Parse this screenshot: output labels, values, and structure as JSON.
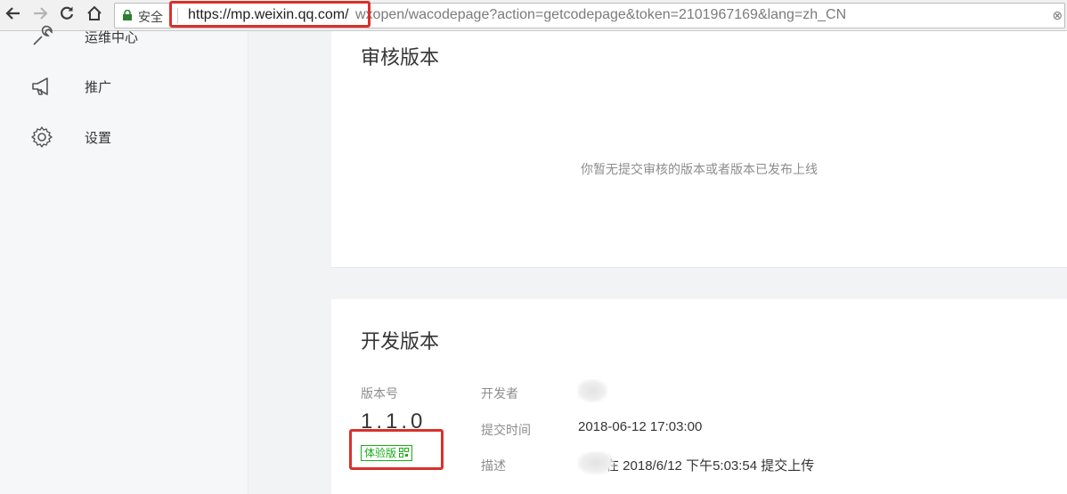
{
  "browser": {
    "secure_label": "安全",
    "url_host": "https://mp.weixin.qq.com/",
    "url_path": "wxopen/wacodepage?action=getcodepage&token=2101967169&lang=zh_CN"
  },
  "sidebar": {
    "items": [
      {
        "label": "运维中心",
        "icon": "wrench-icon"
      },
      {
        "label": "推广",
        "icon": "megaphone-icon"
      },
      {
        "label": "设置",
        "icon": "gear-icon"
      }
    ]
  },
  "review_section": {
    "title": "审核版本",
    "empty_text": "你暂无提交审核的版本或者版本已发布上线"
  },
  "dev_section": {
    "title": "开发版本",
    "version_label": "版本号",
    "version_number": "1.1.0",
    "trial_badge": "体验版",
    "developer_label": "开发者",
    "submit_time_label": "提交时间",
    "submit_time": "2018-06-12 17:03:00",
    "description_label": "描述",
    "description": "在 2018/6/12 下午5:03:54 提交上传"
  },
  "colors": {
    "highlight": "#d9312b",
    "accent_green": "#1aad19"
  }
}
